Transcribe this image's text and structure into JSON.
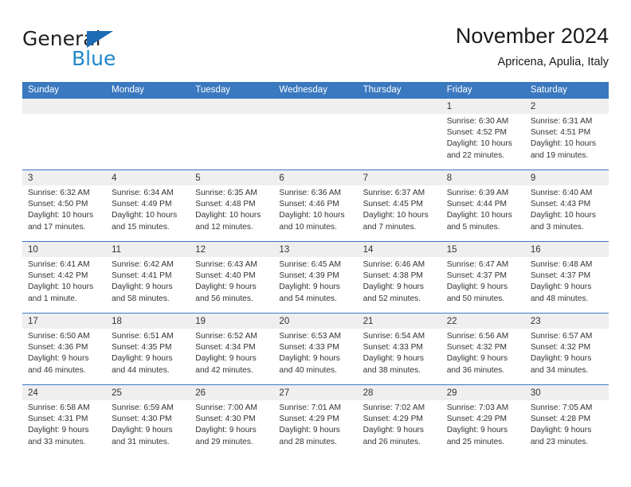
{
  "brand": {
    "name_part1": "General",
    "name_part2": "Blue",
    "triangle_icon": "triangle-icon"
  },
  "header": {
    "title": "November 2024",
    "subtitle": "Apricena, Apulia, Italy"
  },
  "colors": {
    "header_blue": "#3a78bf",
    "daynum_band": "#efefef",
    "brand_dark": "#231f20",
    "brand_blue": "#2087c9"
  },
  "weekdays": [
    "Sunday",
    "Monday",
    "Tuesday",
    "Wednesday",
    "Thursday",
    "Friday",
    "Saturday"
  ],
  "weeks": [
    [
      {
        "day": "",
        "lines": []
      },
      {
        "day": "",
        "lines": []
      },
      {
        "day": "",
        "lines": []
      },
      {
        "day": "",
        "lines": []
      },
      {
        "day": "",
        "lines": []
      },
      {
        "day": "1",
        "lines": [
          "Sunrise: 6:30 AM",
          "Sunset: 4:52 PM",
          "Daylight: 10 hours",
          "and 22 minutes."
        ]
      },
      {
        "day": "2",
        "lines": [
          "Sunrise: 6:31 AM",
          "Sunset: 4:51 PM",
          "Daylight: 10 hours",
          "and 19 minutes."
        ]
      }
    ],
    [
      {
        "day": "3",
        "lines": [
          "Sunrise: 6:32 AM",
          "Sunset: 4:50 PM",
          "Daylight: 10 hours",
          "and 17 minutes."
        ]
      },
      {
        "day": "4",
        "lines": [
          "Sunrise: 6:34 AM",
          "Sunset: 4:49 PM",
          "Daylight: 10 hours",
          "and 15 minutes."
        ]
      },
      {
        "day": "5",
        "lines": [
          "Sunrise: 6:35 AM",
          "Sunset: 4:48 PM",
          "Daylight: 10 hours",
          "and 12 minutes."
        ]
      },
      {
        "day": "6",
        "lines": [
          "Sunrise: 6:36 AM",
          "Sunset: 4:46 PM",
          "Daylight: 10 hours",
          "and 10 minutes."
        ]
      },
      {
        "day": "7",
        "lines": [
          "Sunrise: 6:37 AM",
          "Sunset: 4:45 PM",
          "Daylight: 10 hours",
          "and 7 minutes."
        ]
      },
      {
        "day": "8",
        "lines": [
          "Sunrise: 6:39 AM",
          "Sunset: 4:44 PM",
          "Daylight: 10 hours",
          "and 5 minutes."
        ]
      },
      {
        "day": "9",
        "lines": [
          "Sunrise: 6:40 AM",
          "Sunset: 4:43 PM",
          "Daylight: 10 hours",
          "and 3 minutes."
        ]
      }
    ],
    [
      {
        "day": "10",
        "lines": [
          "Sunrise: 6:41 AM",
          "Sunset: 4:42 PM",
          "Daylight: 10 hours",
          "and 1 minute."
        ]
      },
      {
        "day": "11",
        "lines": [
          "Sunrise: 6:42 AM",
          "Sunset: 4:41 PM",
          "Daylight: 9 hours",
          "and 58 minutes."
        ]
      },
      {
        "day": "12",
        "lines": [
          "Sunrise: 6:43 AM",
          "Sunset: 4:40 PM",
          "Daylight: 9 hours",
          "and 56 minutes."
        ]
      },
      {
        "day": "13",
        "lines": [
          "Sunrise: 6:45 AM",
          "Sunset: 4:39 PM",
          "Daylight: 9 hours",
          "and 54 minutes."
        ]
      },
      {
        "day": "14",
        "lines": [
          "Sunrise: 6:46 AM",
          "Sunset: 4:38 PM",
          "Daylight: 9 hours",
          "and 52 minutes."
        ]
      },
      {
        "day": "15",
        "lines": [
          "Sunrise: 6:47 AM",
          "Sunset: 4:37 PM",
          "Daylight: 9 hours",
          "and 50 minutes."
        ]
      },
      {
        "day": "16",
        "lines": [
          "Sunrise: 6:48 AM",
          "Sunset: 4:37 PM",
          "Daylight: 9 hours",
          "and 48 minutes."
        ]
      }
    ],
    [
      {
        "day": "17",
        "lines": [
          "Sunrise: 6:50 AM",
          "Sunset: 4:36 PM",
          "Daylight: 9 hours",
          "and 46 minutes."
        ]
      },
      {
        "day": "18",
        "lines": [
          "Sunrise: 6:51 AM",
          "Sunset: 4:35 PM",
          "Daylight: 9 hours",
          "and 44 minutes."
        ]
      },
      {
        "day": "19",
        "lines": [
          "Sunrise: 6:52 AM",
          "Sunset: 4:34 PM",
          "Daylight: 9 hours",
          "and 42 minutes."
        ]
      },
      {
        "day": "20",
        "lines": [
          "Sunrise: 6:53 AM",
          "Sunset: 4:33 PM",
          "Daylight: 9 hours",
          "and 40 minutes."
        ]
      },
      {
        "day": "21",
        "lines": [
          "Sunrise: 6:54 AM",
          "Sunset: 4:33 PM",
          "Daylight: 9 hours",
          "and 38 minutes."
        ]
      },
      {
        "day": "22",
        "lines": [
          "Sunrise: 6:56 AM",
          "Sunset: 4:32 PM",
          "Daylight: 9 hours",
          "and 36 minutes."
        ]
      },
      {
        "day": "23",
        "lines": [
          "Sunrise: 6:57 AM",
          "Sunset: 4:32 PM",
          "Daylight: 9 hours",
          "and 34 minutes."
        ]
      }
    ],
    [
      {
        "day": "24",
        "lines": [
          "Sunrise: 6:58 AM",
          "Sunset: 4:31 PM",
          "Daylight: 9 hours",
          "and 33 minutes."
        ]
      },
      {
        "day": "25",
        "lines": [
          "Sunrise: 6:59 AM",
          "Sunset: 4:30 PM",
          "Daylight: 9 hours",
          "and 31 minutes."
        ]
      },
      {
        "day": "26",
        "lines": [
          "Sunrise: 7:00 AM",
          "Sunset: 4:30 PM",
          "Daylight: 9 hours",
          "and 29 minutes."
        ]
      },
      {
        "day": "27",
        "lines": [
          "Sunrise: 7:01 AM",
          "Sunset: 4:29 PM",
          "Daylight: 9 hours",
          "and 28 minutes."
        ]
      },
      {
        "day": "28",
        "lines": [
          "Sunrise: 7:02 AM",
          "Sunset: 4:29 PM",
          "Daylight: 9 hours",
          "and 26 minutes."
        ]
      },
      {
        "day": "29",
        "lines": [
          "Sunrise: 7:03 AM",
          "Sunset: 4:29 PM",
          "Daylight: 9 hours",
          "and 25 minutes."
        ]
      },
      {
        "day": "30",
        "lines": [
          "Sunrise: 7:05 AM",
          "Sunset: 4:28 PM",
          "Daylight: 9 hours",
          "and 23 minutes."
        ]
      }
    ]
  ]
}
